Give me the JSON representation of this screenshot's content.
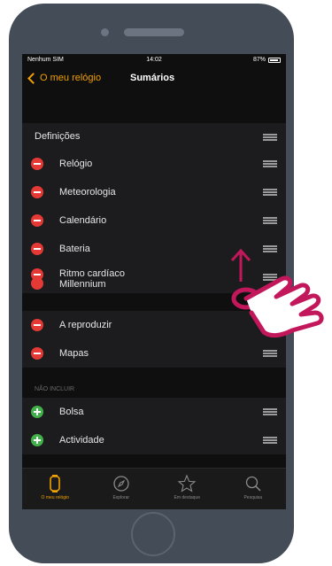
{
  "status_bar": {
    "carrier": "Nenhum SIM",
    "time": "14:02",
    "battery": "87%"
  },
  "nav": {
    "back_label": "O meu relógio",
    "title": "Sumários"
  },
  "section": {
    "title": "Definições"
  },
  "included_items": [
    {
      "label": "Relógio"
    },
    {
      "label": "Meteorologia"
    },
    {
      "label": "Calendário"
    },
    {
      "label": "Bateria"
    }
  ],
  "dragging_item": {
    "label": "Ritmo cardíaco",
    "label_under": "Millennium"
  },
  "included_items_after": [
    {
      "label": "A reproduzir"
    },
    {
      "label": "Mapas"
    }
  ],
  "not_included_header": "NÃO INCLUIR",
  "not_included_items": [
    {
      "label": "Bolsa"
    },
    {
      "label": "Actividade"
    }
  ],
  "tab_bar": {
    "tabs": [
      {
        "label": "O meu relógio",
        "icon": "watch-icon",
        "active": true
      },
      {
        "label": "Explorar",
        "icon": "compass-icon",
        "active": false
      },
      {
        "label": "Em destaque",
        "icon": "star-icon",
        "active": false
      },
      {
        "label": "Pesquisa",
        "icon": "search-icon",
        "active": false
      }
    ]
  },
  "colors": {
    "accent": "#f0a000",
    "remove": "#e53935",
    "add": "#43b14b",
    "hand": "#c2185b"
  }
}
